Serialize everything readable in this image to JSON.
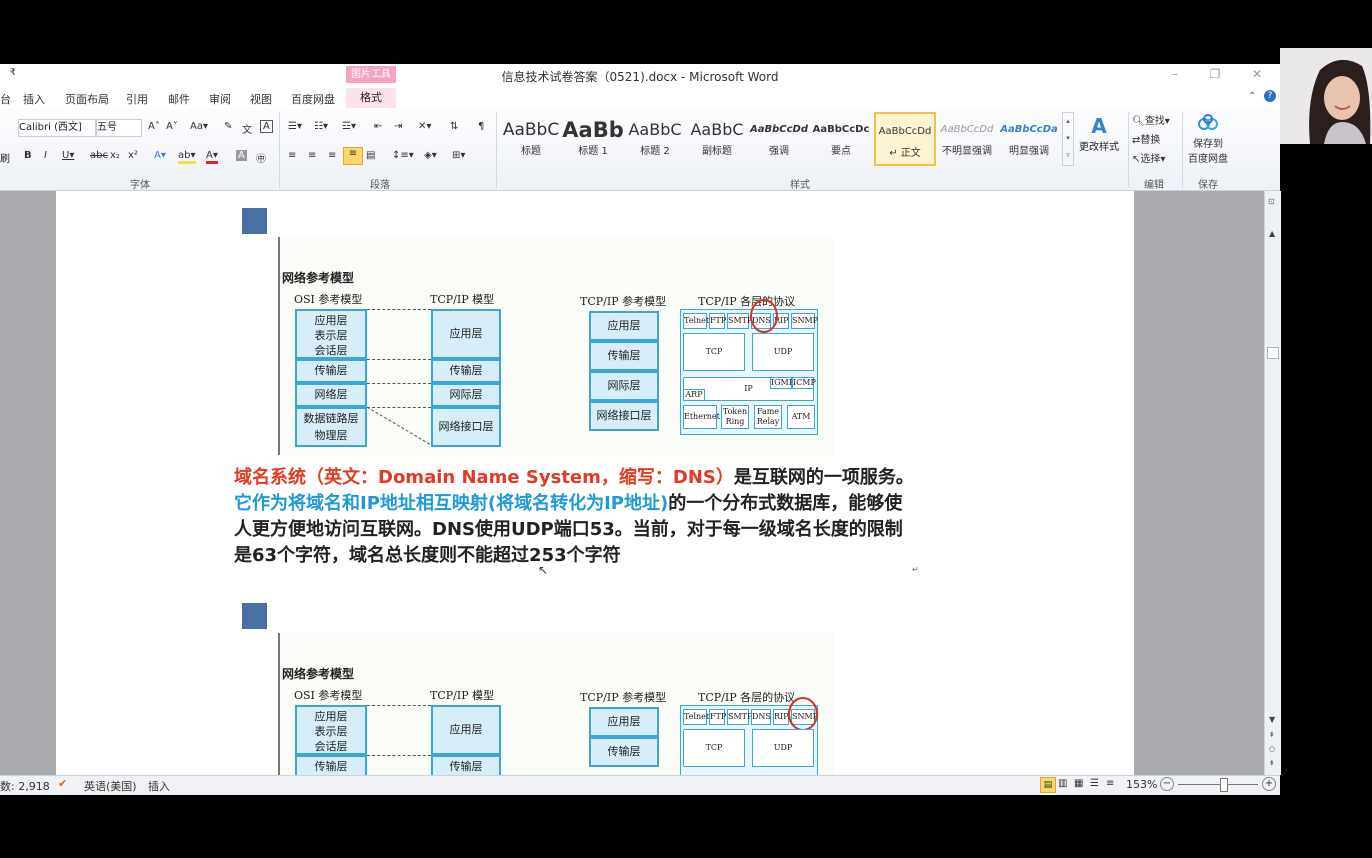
{
  "window": {
    "title": "信息技术试卷答案（0521).docx - Microsoft Word",
    "context_tab_group": "图片工具",
    "quick_access_marker": "₹"
  },
  "tabs": [
    "插入",
    "页面布局",
    "引用",
    "邮件",
    "审阅",
    "视图",
    "百度网盘"
  ],
  "context_tab": "格式",
  "ribbon": {
    "font_name": "Calibri (西文]",
    "font_size": "五号",
    "groups": {
      "font": "字体",
      "paragraph": "段落",
      "styles": "样式",
      "editing": "编辑",
      "save": "保存"
    },
    "styles": [
      {
        "preview": "AaBbC",
        "name": "标题"
      },
      {
        "preview": "AaBb",
        "name": "标题 1"
      },
      {
        "preview": "AaBbC",
        "name": "标题 2"
      },
      {
        "preview": "AaBbC",
        "name": "副标题"
      },
      {
        "preview": "AaBbCcDd",
        "name": "强调"
      },
      {
        "preview": "AaBbCcDc",
        "name": "要点"
      },
      {
        "preview": "AaBbCcDd",
        "name": "↵ 正文"
      },
      {
        "preview": "AaBbCcDd",
        "name": "不明显强调"
      },
      {
        "preview": "AaBbCcDa",
        "name": "明显强调"
      }
    ],
    "change_styles": "更改样式",
    "find": "查找",
    "replace": "替换",
    "select": "选择",
    "save_to_baidu_line1": "保存到",
    "save_to_baidu_line2": "百度网盘"
  },
  "figure": {
    "title": "网络参考模型",
    "osi_header": "OSI 参考模型",
    "tcpip_header": "TCP/IP 模型",
    "tcpip_ref_header": "TCP/IP 参考模型",
    "protocols_header": "TCP/IP 各层的协议",
    "osi_layers": [
      "应用层",
      "表示层",
      "会话层",
      "传输层",
      "网络层",
      "数据链路层",
      "物理层"
    ],
    "tcpip_layers": [
      "应用层",
      "传输层",
      "网际层",
      "网络接口层"
    ],
    "protocols": {
      "app": [
        "Telnet",
        "FTP",
        "SMTP",
        "DNS",
        "RIP",
        "SNMP"
      ],
      "transport": [
        "TCP",
        "UDP"
      ],
      "internet": [
        "IP",
        "IGMP",
        "ICMP",
        "ARP"
      ],
      "link": [
        "Ethernet",
        "Token Ring",
        "Fame Relay",
        "ATM"
      ]
    }
  },
  "paragraph": {
    "red": "域名系统（英文：Domain Name System，缩写：DNS）",
    "black1": "是互联网的一项服务。",
    "blue": "它作为将域名和IP地址相互映射(将域名转化为IP地址)",
    "black2": "的一个分布式数据库，能够使人更方便地访问互联网。DNS使用UDP端口53。当前，对于每一级域名长度的限制是63个字符，域名总长度则不能超过253个字符"
  },
  "status": {
    "word_count": "数: 2,918",
    "language": "英语(美国)",
    "mode": "插入",
    "zoom": "153%"
  },
  "colors": {
    "red_text": "#e23a25",
    "blue_text": "#1f9ad6",
    "layer_border": "#3aa7d9",
    "layer_fill": "#d7eef9",
    "heading_square": "#4a6fa5",
    "circle": "#d63024"
  }
}
